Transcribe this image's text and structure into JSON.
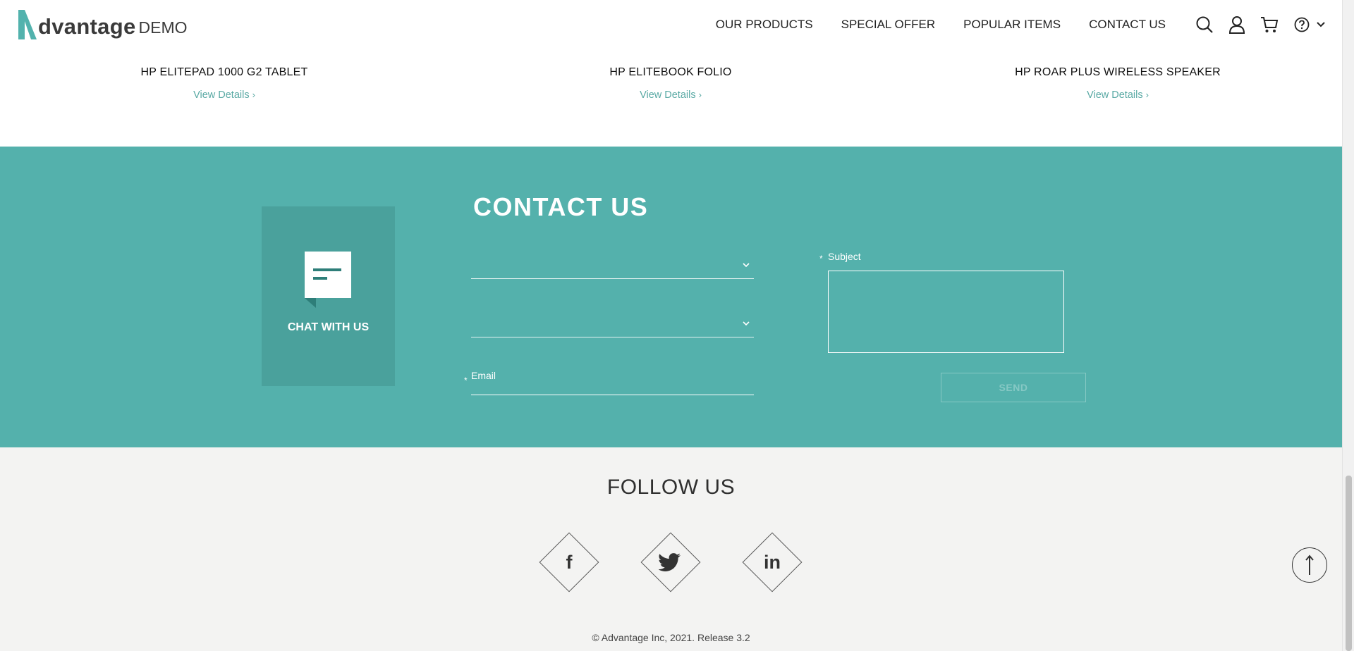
{
  "header": {
    "logo_word": "dvantage",
    "logo_demo": "DEMO",
    "nav": [
      "OUR PRODUCTS",
      "SPECIAL OFFER",
      "POPULAR ITEMS",
      "CONTACT US"
    ],
    "icons": [
      "search-icon",
      "user-icon",
      "cart-icon",
      "help-icon",
      "chevron-down-icon"
    ]
  },
  "products": [
    {
      "name": "HP ELITEPAD 1000 G2 TABLET",
      "link": "View Details"
    },
    {
      "name": "HP ELITEBOOK FOLIO",
      "link": "View Details"
    },
    {
      "name": "HP ROAR PLUS WIRELESS SPEAKER",
      "link": "View Details"
    }
  ],
  "contact": {
    "title": "CONTACT US",
    "chat_label": "CHAT WITH US",
    "category_value": "",
    "product_value": "",
    "email_label": "Email",
    "subject_label": "Subject",
    "required_mark": "*",
    "send_label": "SEND"
  },
  "follow": {
    "title": "FOLLOW US",
    "social": [
      {
        "name": "facebook",
        "glyph": "f"
      },
      {
        "name": "twitter",
        "glyph": "twitter-bird"
      },
      {
        "name": "linkedin",
        "glyph": "in"
      }
    ],
    "copyright": "© Advantage Inc, 2021. Release 3.2"
  },
  "colors": {
    "accent": "#54b1ac",
    "chat_box": "#4aa19c",
    "link": "#59a9a4",
    "footer_bg": "#f3f3f2"
  }
}
